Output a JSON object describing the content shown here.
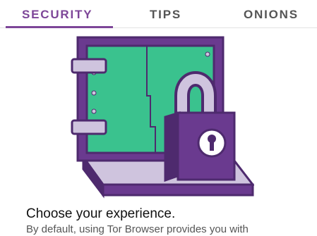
{
  "tabs": [
    {
      "label": "SECURITY",
      "active": true
    },
    {
      "label": "TIPS",
      "active": false
    },
    {
      "label": "ONIONS",
      "active": false
    }
  ],
  "content": {
    "headline": "Choose your experience.",
    "description": "By default, using Tor Browser provides you with"
  },
  "colors": {
    "accent": "#7d4698",
    "purple_dark": "#4e2a6e",
    "purple_mid": "#6a3a8f",
    "teal": "#3ac28e",
    "lavender": "#cfc4de"
  },
  "illustration": {
    "icon": "safe-with-padlock"
  }
}
